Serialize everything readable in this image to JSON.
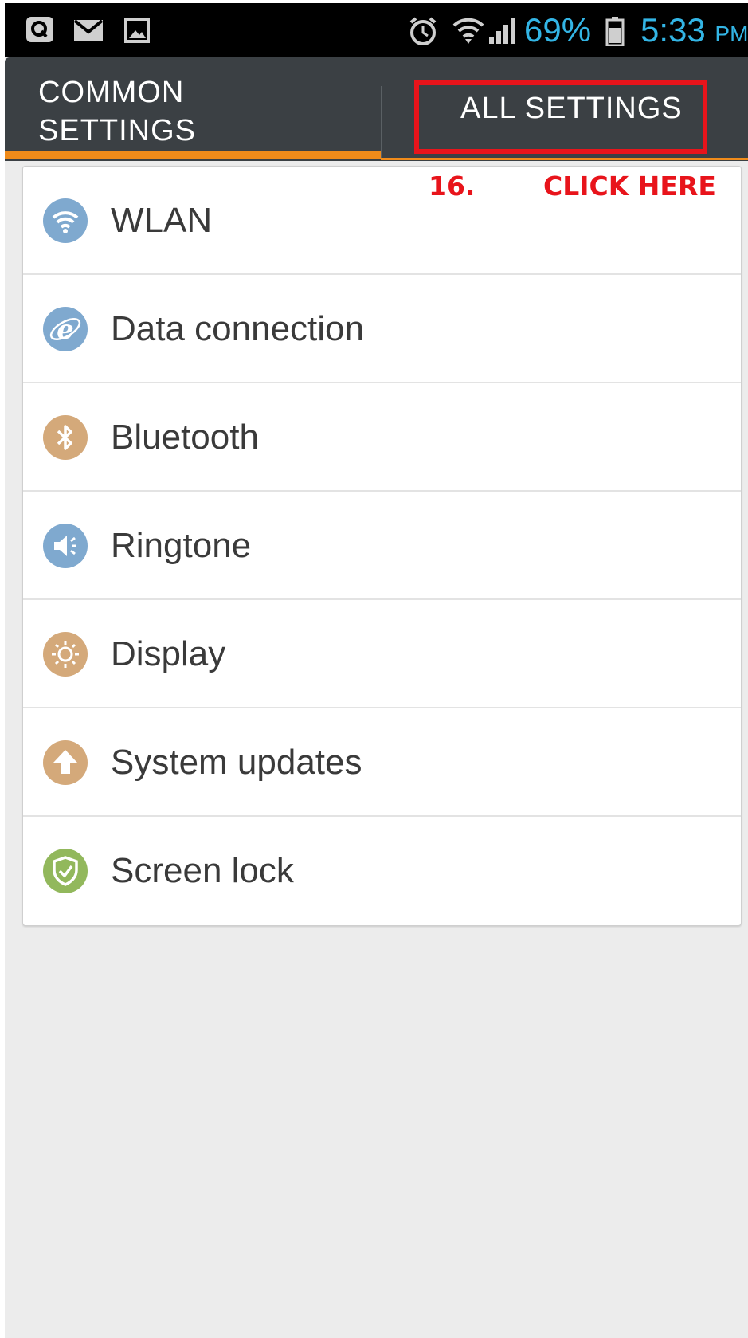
{
  "status_bar": {
    "battery_percent": "69%",
    "time": "5:33",
    "ampm": "PM",
    "accent_color": "#33b5e5",
    "icons": [
      "q-app-icon",
      "mail-icon",
      "image-icon",
      "alarm-icon",
      "wifi-icon",
      "signal-icon",
      "battery-icon"
    ]
  },
  "tabs": [
    {
      "label": "COMMON SETTINGS",
      "selected": true
    },
    {
      "label": "ALL SETTINGS",
      "selected": false
    }
  ],
  "annotation": {
    "step": "16.",
    "text": "CLICK HERE",
    "color": "#e8141b"
  },
  "settings": [
    {
      "label": "WLAN",
      "icon": "wifi-icon",
      "icon_color": "#7fa9cf"
    },
    {
      "label": "Data connection",
      "icon": "globe-e-icon",
      "icon_color": "#7fa9cf"
    },
    {
      "label": "Bluetooth",
      "icon": "bluetooth-icon",
      "icon_color": "#d4a97a"
    },
    {
      "label": "Ringtone",
      "icon": "speaker-icon",
      "icon_color": "#7fa9cf"
    },
    {
      "label": "Display",
      "icon": "sun-icon",
      "icon_color": "#d4a97a"
    },
    {
      "label": "System updates",
      "icon": "upload-arrow-icon",
      "icon_color": "#d4a97a"
    },
    {
      "label": "Screen lock",
      "icon": "shield-icon",
      "icon_color": "#92b85c"
    }
  ],
  "colors": {
    "tab_bar": "#3b4044",
    "tab_indicator": "#f08b1a",
    "background": "#ececec"
  }
}
